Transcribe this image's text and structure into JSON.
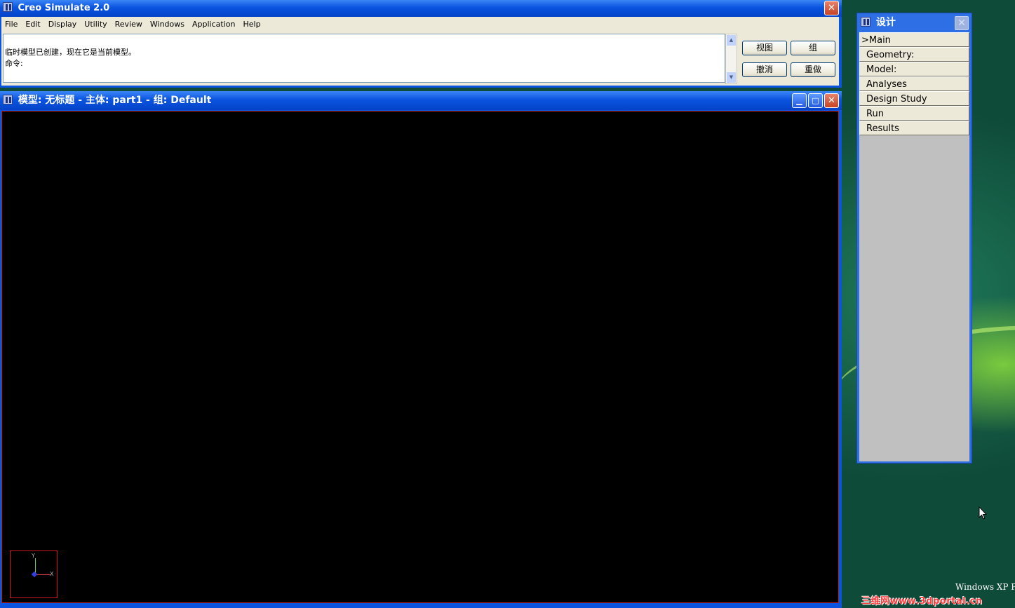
{
  "main_window": {
    "title": "Creo Simulate 2.0",
    "close_label": "✕",
    "menu": [
      "File",
      "Edit",
      "Display",
      "Utility",
      "Review",
      "Windows",
      "Application",
      "Help"
    ],
    "messages": [
      "临时模型已创建，现在它是当前模型。",
      "命令:"
    ],
    "buttons": {
      "view": "视图",
      "group": "组",
      "undo": "撤消",
      "redo": "重做"
    }
  },
  "model_window": {
    "title": "模型: 无标题 - 主体: part1 - 组: Default",
    "minimize_label": "▁",
    "maximize_label": "□",
    "close_label": "✕",
    "triad": {
      "y_label": "Y",
      "x_label": "X"
    }
  },
  "design_window": {
    "title": "设计",
    "close_label": "✕",
    "items": [
      ">Main",
      "Geometry:",
      "Model:",
      "Analyses",
      "Design Study",
      "Run",
      "Results"
    ]
  },
  "desktop": {
    "os_label": "Windows XP P",
    "watermark": "三维网www.3dportal.cn"
  },
  "colors": {
    "title_blue": "#0a54e0",
    "viewport_bg": "#000000",
    "panel_gray": "#c0c0c0",
    "button_face": "#ece9d8"
  }
}
